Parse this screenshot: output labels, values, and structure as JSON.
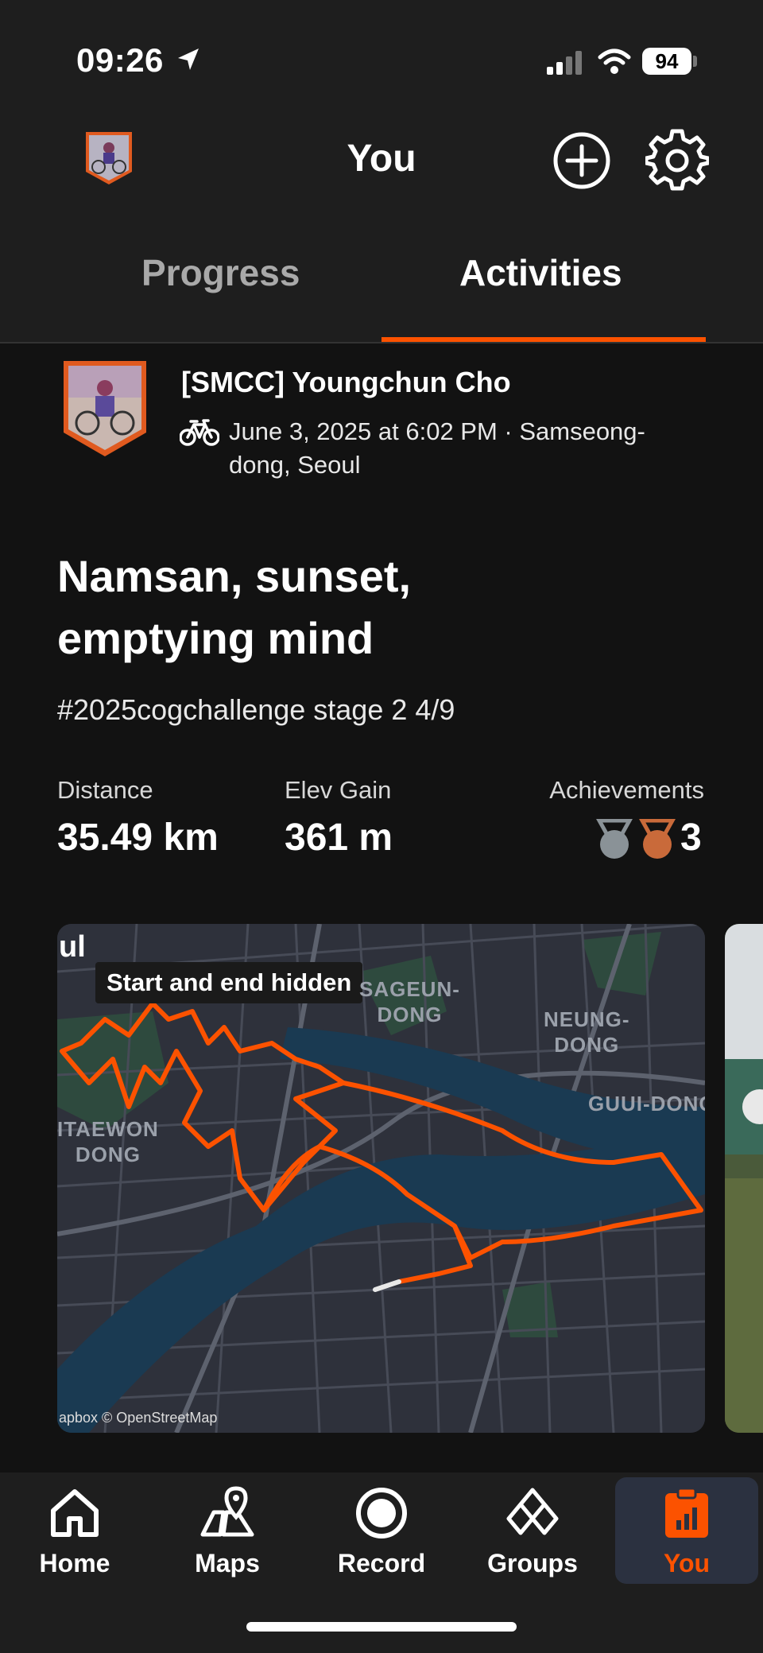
{
  "status_bar": {
    "time": "09:26",
    "battery": "94"
  },
  "header": {
    "title": "You"
  },
  "tabs": [
    {
      "label": "Progress"
    },
    {
      "label": "Activities"
    }
  ],
  "activity": {
    "athlete": "[SMCC] Youngchun Cho",
    "meta": "June 3, 2025 at 6:02 PM · Samseong-dong, Seoul",
    "title": "Namsan, sunset, emptying mind",
    "description": "#2025cogchallenge stage 2 4/9",
    "stats": [
      {
        "label": "Distance",
        "value": "35.49 km"
      },
      {
        "label": "Elev Gain",
        "value": "361 m"
      },
      {
        "label": "Achievements",
        "value": "3"
      }
    ],
    "map": {
      "badge": "Start and end hidden",
      "attribution": "apbox © OpenStreetMap",
      "labels": {
        "ul": "ul",
        "sageun": "SAGEUN-\nDONG",
        "neung": "NEUNG-\nDONG",
        "guui": "GUUI-DONG",
        "itaewon": "ITAEWON\nDONG"
      }
    }
  },
  "nav": [
    {
      "label": "Home",
      "icon": "home-icon"
    },
    {
      "label": "Maps",
      "icon": "maps-icon"
    },
    {
      "label": "Record",
      "icon": "record-icon"
    },
    {
      "label": "Groups",
      "icon": "groups-icon"
    },
    {
      "label": "You",
      "icon": "you-icon"
    }
  ],
  "colors": {
    "accent": "#fc5200",
    "background": "#121212",
    "header": "#1e1e1e"
  }
}
